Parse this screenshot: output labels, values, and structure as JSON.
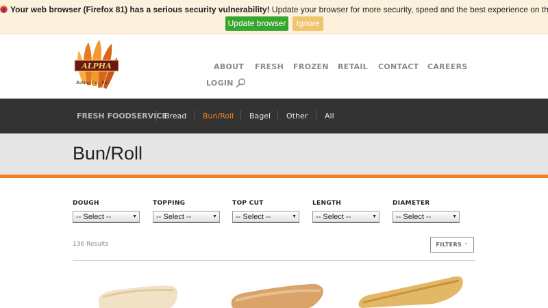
{
  "notice": {
    "icon": "firefox-icon",
    "strong": "Your web browser (Firefox 81) has a serious security vulnerability!",
    "rest": " Update your browser for more security, speed and the best experience on this site.",
    "update_label": "Update browser",
    "ignore_label": "Ignore"
  },
  "logo": {
    "text": "ALPHA",
    "sub": "Baking Co., Inc."
  },
  "nav": {
    "items": [
      "ABOUT",
      "FRESH",
      "FROZEN",
      "RETAIL",
      "CONTACT",
      "CAREERS",
      "LOGIN"
    ],
    "search_icon": "search-icon"
  },
  "categories": {
    "heading": "FRESH FOODSERVICE",
    "items": [
      "Bread",
      "Bun/Roll",
      "Bagel",
      "Other",
      "All"
    ],
    "active": "Bun/Roll"
  },
  "page": {
    "title": "Bun/Roll"
  },
  "filters": {
    "fields": [
      {
        "label": "DOUGH",
        "value": "-- Select --"
      },
      {
        "label": "TOPPING",
        "value": "-- Select --"
      },
      {
        "label": "TOP CUT",
        "value": "-- Select --"
      },
      {
        "label": "LENGTH",
        "value": "-- Select --"
      },
      {
        "label": "DIAMETER",
        "value": "-- Select --"
      }
    ],
    "results": "136 Results",
    "button_label": "FILTERS",
    "button_icon": "chevron-up-icon"
  },
  "colors": {
    "accent": "#f58220",
    "catbar": "#333333",
    "update": "#37a52e",
    "ignore": "#f0c36d"
  },
  "products": [
    {
      "name": "product-image",
      "kind": "white-sub-roll"
    },
    {
      "name": "product-image",
      "kind": "toasted-sub-roll"
    },
    {
      "name": "product-image",
      "kind": "golden-sub-roll"
    }
  ]
}
